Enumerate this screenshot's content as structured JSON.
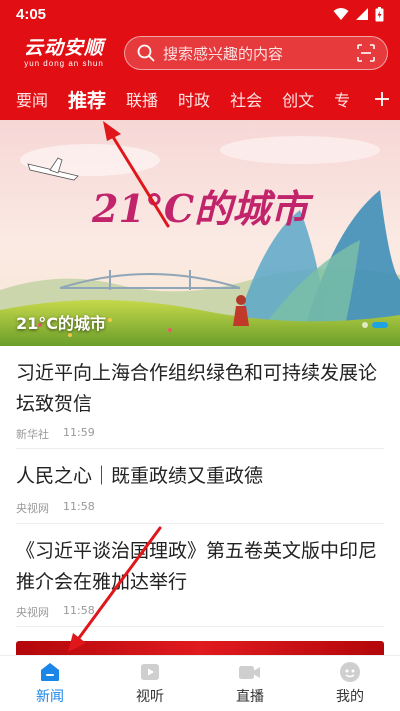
{
  "status_bar": {
    "time": "4:05"
  },
  "header": {
    "logo_cn": "云动安顺",
    "logo_pinyin": "yun dong an shun",
    "search_placeholder": "搜索感兴趣的内容",
    "search_icon": "search-icon",
    "scan_icon": "scan-icon"
  },
  "tabs": [
    {
      "label": "要闻",
      "active": false
    },
    {
      "label": "推荐",
      "active": true
    },
    {
      "label": "联播",
      "active": false
    },
    {
      "label": "时政",
      "active": false
    },
    {
      "label": "社会",
      "active": false
    },
    {
      "label": "创文",
      "active": false
    },
    {
      "label": "专",
      "active": false
    }
  ],
  "banner": {
    "caption": "21°C的城市",
    "art_title": "21°C的城市",
    "dots": 2,
    "active_dot": 1
  },
  "news": [
    {
      "title": "习近平向上海合作组织绿色和可持续发展论坛致贺信",
      "source": "新华社",
      "time": "11:59"
    },
    {
      "title": "人民之心｜既重政绩又重政德",
      "source": "央视网",
      "time": "11:58"
    },
    {
      "title": "《习近平谈治国理政》第五卷英文版中印尼推介会在雅加达举行",
      "source": "央视网",
      "time": "11:58"
    }
  ],
  "bottom_nav": [
    {
      "label": "新闻",
      "icon": "home-icon",
      "active": true
    },
    {
      "label": "视听",
      "icon": "play-icon",
      "active": false
    },
    {
      "label": "直播",
      "icon": "video-camera-icon",
      "active": false
    },
    {
      "label": "我的",
      "icon": "profile-icon",
      "active": false
    }
  ],
  "colors": {
    "brand_red": "#e10f13",
    "nav_active_blue": "#1a86e8",
    "annotation_arrow": "#e0161b"
  }
}
